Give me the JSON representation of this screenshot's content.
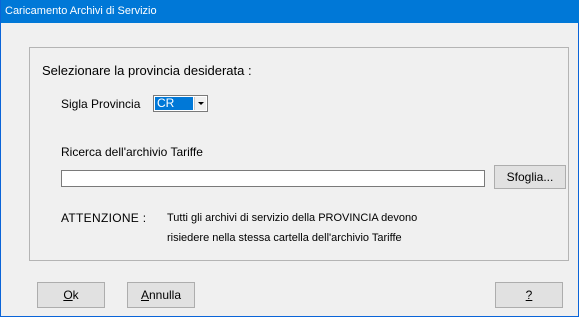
{
  "window": {
    "title": "Caricamento Archivi di Servizio"
  },
  "group": {
    "heading": "Selezionare la provincia desiderata :"
  },
  "provincia": {
    "label": "Sigla Provincia",
    "selected_value": "CR"
  },
  "archivio": {
    "label": "Ricerca dell'archivio Tariffe",
    "value": "",
    "browse_button": "Sfoglia..."
  },
  "warning": {
    "label": "ATTENZIONE :",
    "line1": "Tutti gli archivi di servizio della PROVINCIA devono",
    "line2": "risiedere nella stessa cartella dell'archivio Tariffe"
  },
  "buttons": {
    "ok_mnemonic": "O",
    "ok_rest": "k",
    "annulla_mnemonic": "A",
    "annulla_rest": "nnulla",
    "help": "?"
  },
  "icons": {
    "combo_arrow": "chevron-down-icon"
  }
}
